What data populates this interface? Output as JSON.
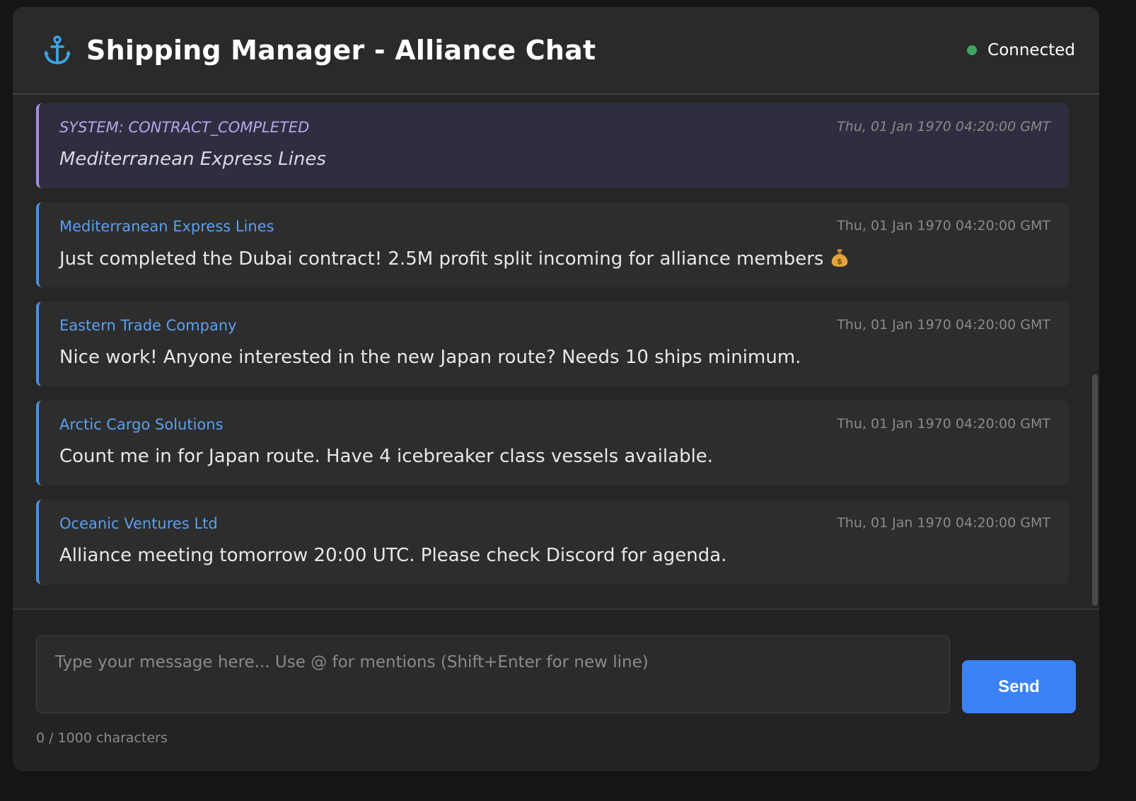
{
  "header": {
    "icon": "anchor-icon",
    "title": "Shipping Manager - Alliance Chat",
    "status_label": "Connected",
    "status_color": "#3fa45f"
  },
  "messages": [
    {
      "type": "system",
      "author": "SYSTEM: CONTRACT_COMPLETED",
      "time": "Thu, 01 Jan 1970 04:20:00 GMT",
      "text": "Mediterranean Express Lines"
    },
    {
      "type": "user",
      "author": "Mediterranean Express Lines",
      "time": "Thu, 01 Jan 1970 04:20:00 GMT",
      "text": "Just completed the Dubai contract! 2.5M profit split incoming for alliance members",
      "emoji": "money-bag-icon"
    },
    {
      "type": "user",
      "author": "Eastern Trade Company",
      "time": "Thu, 01 Jan 1970 04:20:00 GMT",
      "text": "Nice work! Anyone interested in the new Japan route? Needs 10 ships minimum."
    },
    {
      "type": "user",
      "author": "Arctic Cargo Solutions",
      "time": "Thu, 01 Jan 1970 04:20:00 GMT",
      "text": "Count me in for Japan route. Have 4 icebreaker class vessels available."
    },
    {
      "type": "user",
      "author": "Oceanic Ventures Ltd",
      "time": "Thu, 01 Jan 1970 04:20:00 GMT",
      "text": "Alliance meeting tomorrow 20:00 UTC. Please check Discord for agenda."
    }
  ],
  "composer": {
    "placeholder": "Type your message here... Use @ for mentions (Shift+Enter for new line)",
    "value": "",
    "send_label": "Send",
    "counter": "0 / 1000 characters"
  },
  "colors": {
    "accent": "#3b82f6",
    "author": "#5aa0ef",
    "system_accent": "#a98ae0"
  }
}
